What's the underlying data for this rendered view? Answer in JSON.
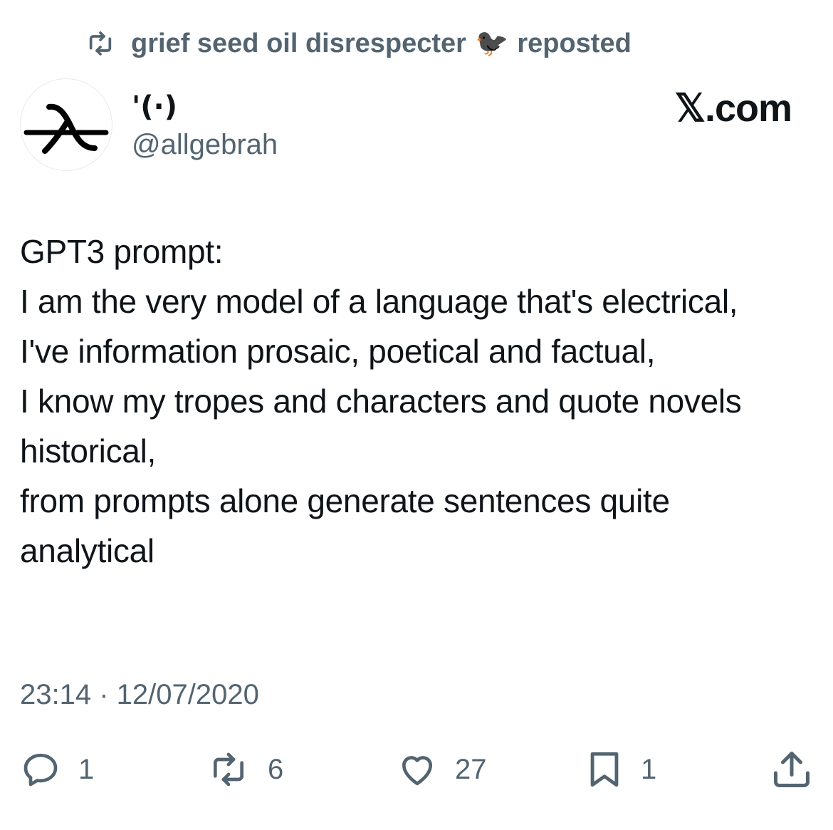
{
  "repost": {
    "user": "grief seed oil disrespecter",
    "emoji": "🐦‍⬛",
    "suffix": "reposted"
  },
  "author": {
    "display_name": "'(·)",
    "handle": "@allgebrah"
  },
  "brand": "𝕏.com",
  "tweet": {
    "text": "GPT3 prompt:\nI am the very model of a language that's electrical,\nI've information prosaic, poetical and factual,\nI know my tropes and characters and quote novels historical,\nfrom prompts alone generate sentences quite analytical",
    "timestamp": "23:14 · 12/07/2020"
  },
  "actions": {
    "replies": "1",
    "reposts": "6",
    "likes": "27",
    "bookmarks": "1"
  },
  "colors": {
    "text": "#0f1419",
    "secondary": "#536471"
  }
}
